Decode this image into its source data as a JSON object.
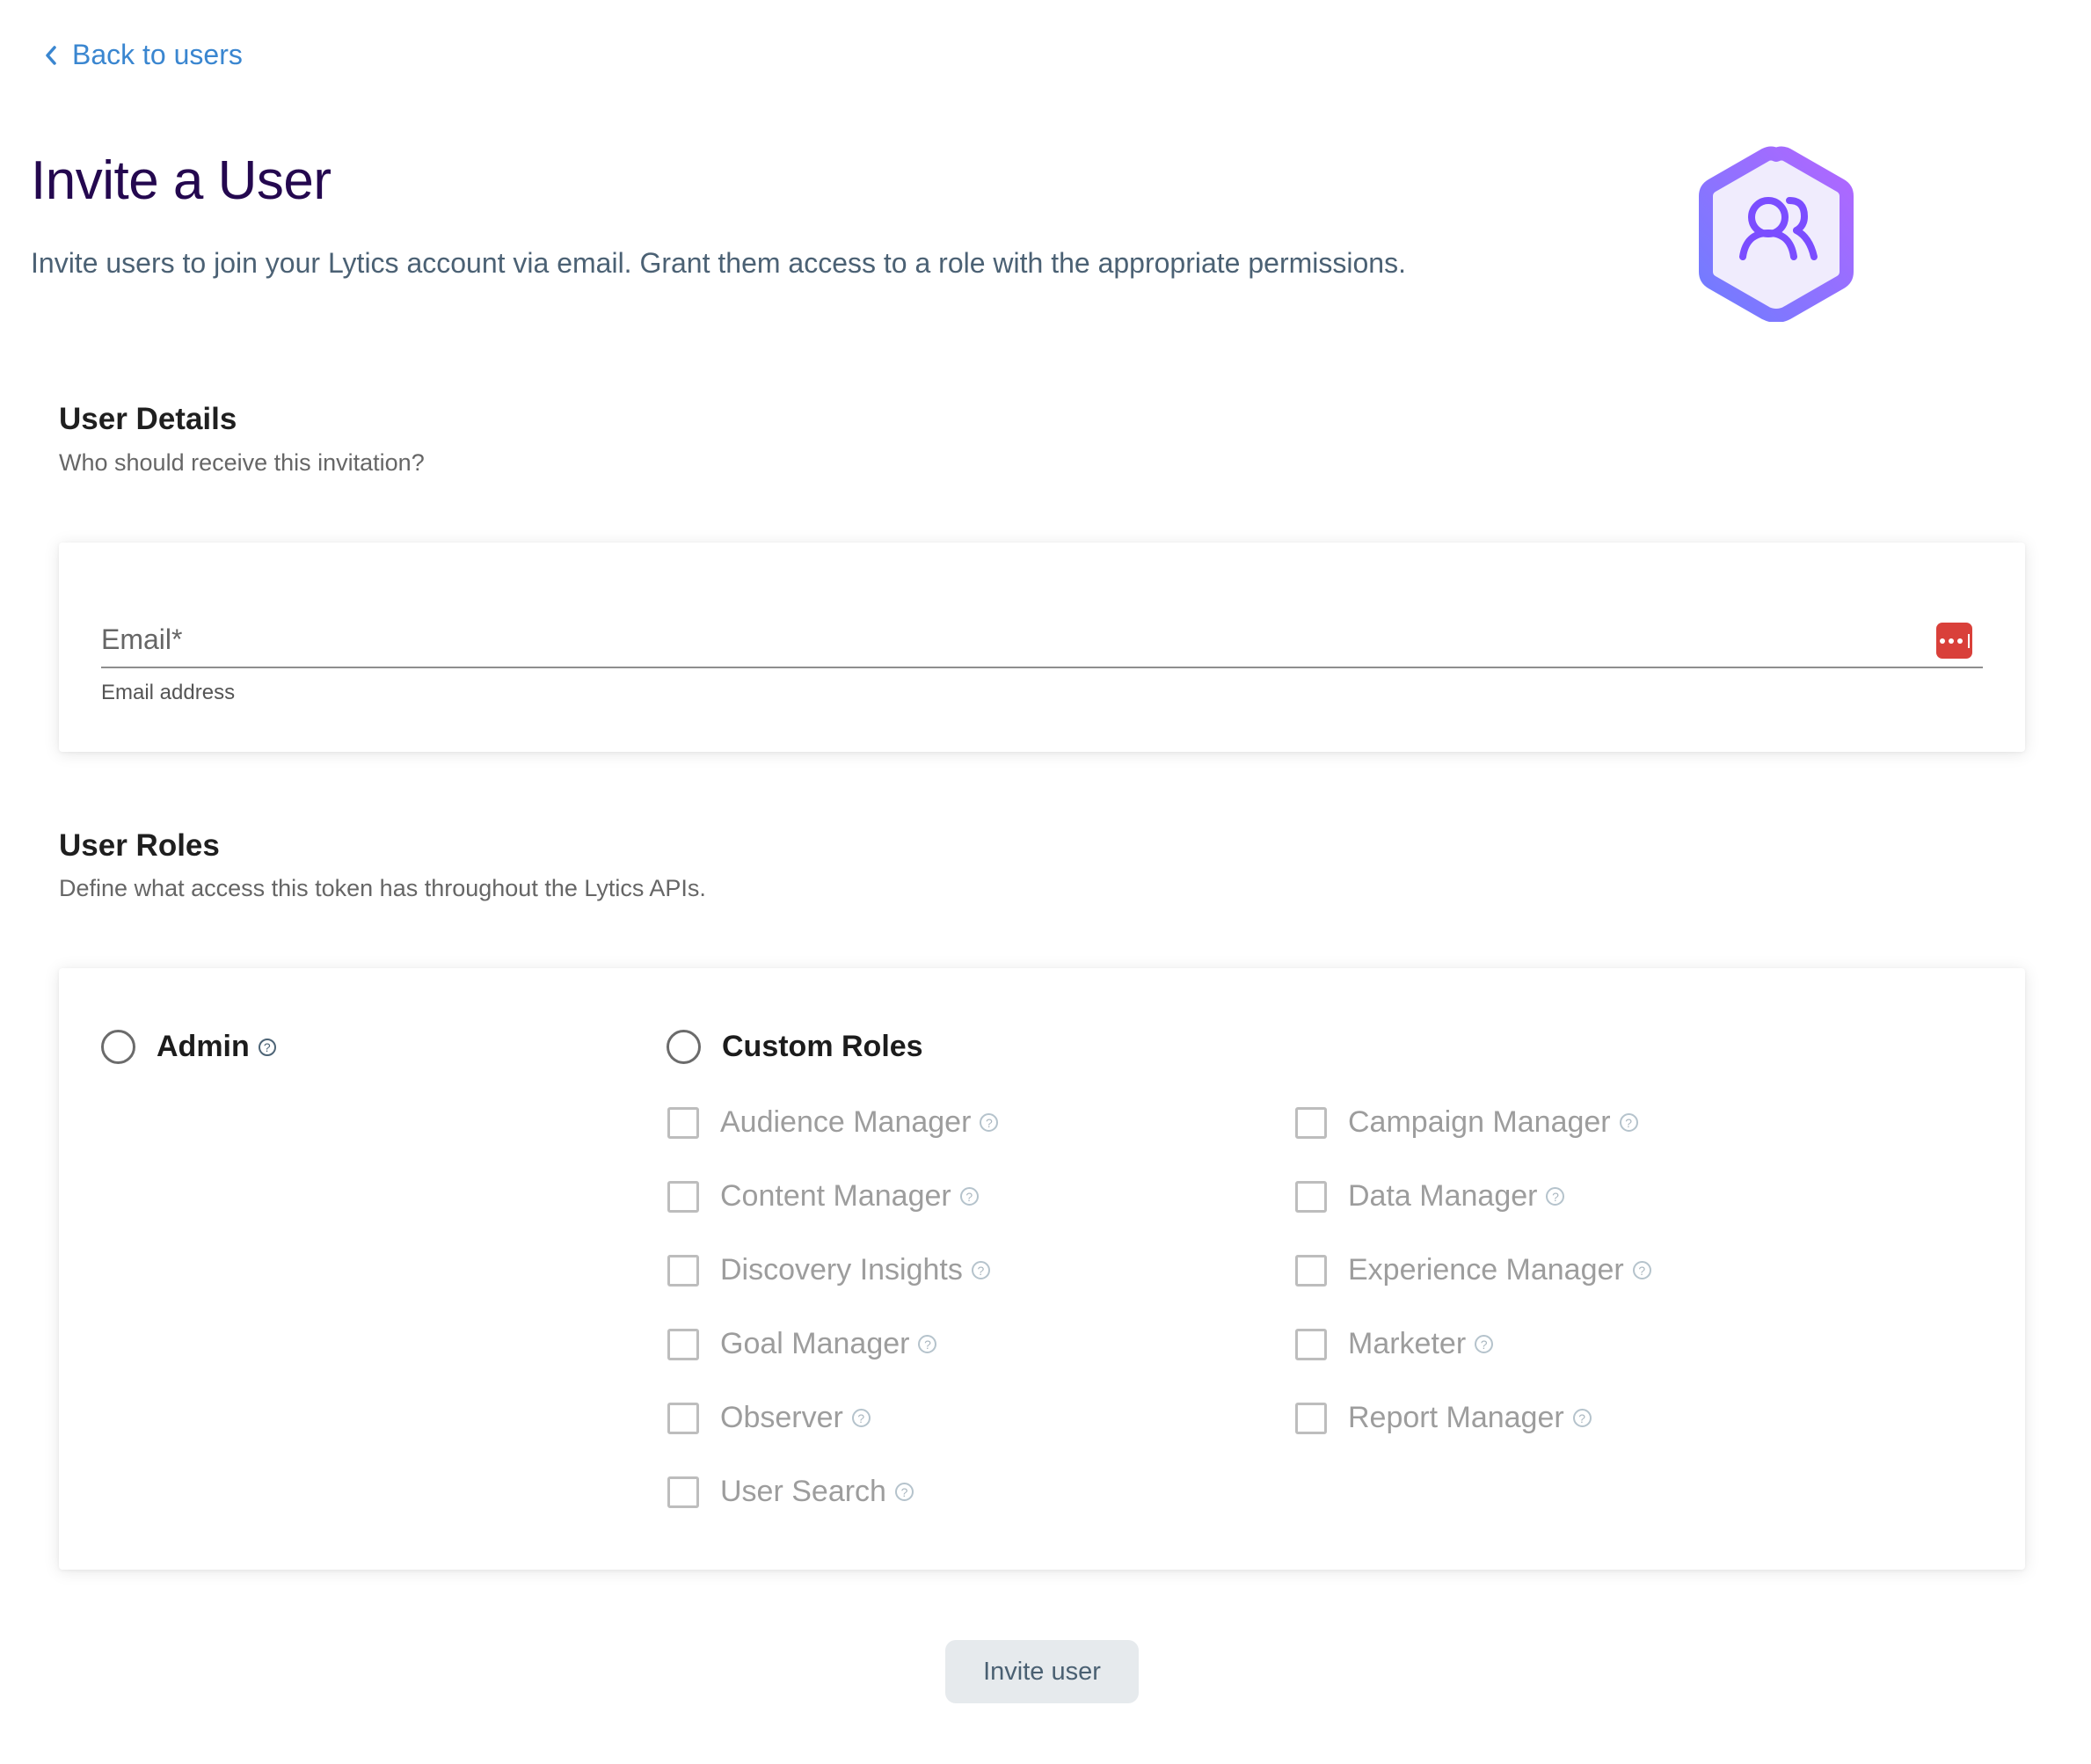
{
  "nav": {
    "back_label": "Back to users",
    "back_icon": "chevron-left-icon"
  },
  "header": {
    "title": "Invite a User",
    "description": "Invite users to join your Lytics account via email. Grant them access to a role with the appropriate permissions.",
    "icon": "users-hexagon-icon"
  },
  "user_details": {
    "title": "User Details",
    "subtitle": "Who should receive this invitation?",
    "email": {
      "label": "Email*",
      "value": "",
      "helper": "Email address",
      "autofill_icon": "password-manager-icon"
    }
  },
  "user_roles": {
    "title": "User Roles",
    "subtitle": "Define what access this token has throughout the Lytics APIs.",
    "admin": {
      "label": "Admin",
      "selected": false,
      "help_icon": "help-circle-icon"
    },
    "custom": {
      "label": "Custom Roles",
      "selected": false
    },
    "roles_left": [
      {
        "label": "Audience Manager",
        "checked": false
      },
      {
        "label": "Content Manager",
        "checked": false
      },
      {
        "label": "Discovery Insights",
        "checked": false
      },
      {
        "label": "Goal Manager",
        "checked": false
      },
      {
        "label": "Observer",
        "checked": false
      },
      {
        "label": "User Search",
        "checked": false
      }
    ],
    "roles_right": [
      {
        "label": "Campaign Manager",
        "checked": false
      },
      {
        "label": "Data Manager",
        "checked": false
      },
      {
        "label": "Experience Manager",
        "checked": false
      },
      {
        "label": "Marketer",
        "checked": false
      },
      {
        "label": "Report Manager",
        "checked": false
      }
    ],
    "help_glyph": "?"
  },
  "actions": {
    "invite_label": "Invite user"
  },
  "colors": {
    "link": "#3a86d0",
    "title": "#24084f",
    "accent_gradient_start": "#6f7dff",
    "accent_gradient_end": "#b266ff",
    "icon_fill": "#7b4dff",
    "autofill_red": "#d9403a"
  }
}
